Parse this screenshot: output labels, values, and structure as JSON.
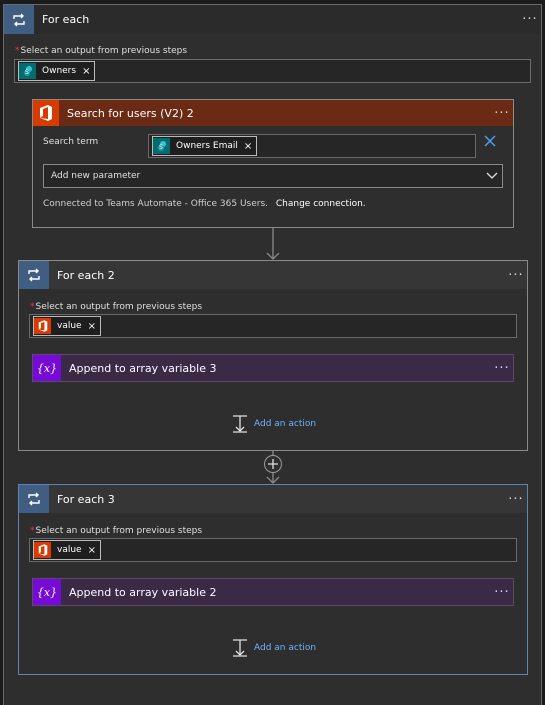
{
  "foreach1": {
    "title": "For each",
    "field_label": "Select an output from previous steps",
    "required_mark": "*",
    "token": {
      "label": "Owners",
      "icon": "sharepoint-icon",
      "remove": "×"
    },
    "menu": "···"
  },
  "search_users": {
    "title": "Search for users (V2) 2",
    "menu": "···",
    "search_term_label": "Search term",
    "token": {
      "label": "Owners Email",
      "icon": "sharepoint-icon",
      "remove": "×"
    },
    "clear_icon": "×",
    "add_param_placeholder": "Add new parameter",
    "connection_text": "Connected to Teams Automate - Office 365 Users.",
    "change_connection": "Change connection."
  },
  "foreach2": {
    "title": "For each 2",
    "menu": "···",
    "field_label": "Select an output from previous steps",
    "required_mark": "*",
    "token": {
      "label": "value",
      "icon": "office-icon",
      "remove": "×"
    },
    "action": {
      "title": "Append to array variable 3",
      "badge": "{x}",
      "menu": "···"
    },
    "add_action": "Add an action"
  },
  "foreach3": {
    "title": "For each 3",
    "menu": "···",
    "field_label": "Select an output from previous steps",
    "required_mark": "*",
    "token": {
      "label": "value",
      "icon": "office-icon",
      "remove": "×"
    },
    "action": {
      "title": "Append to array variable 2",
      "badge": "{x}",
      "menu": "···"
    },
    "add_action": "Add an action"
  },
  "colors": {
    "loop_badge": "#3f5e82",
    "office_orange": "#d83b01",
    "sharepoint_teal": "#036c70",
    "variable_purple": "#770bd6",
    "link_blue": "#6fb3ff",
    "required_red": "#e04040"
  }
}
